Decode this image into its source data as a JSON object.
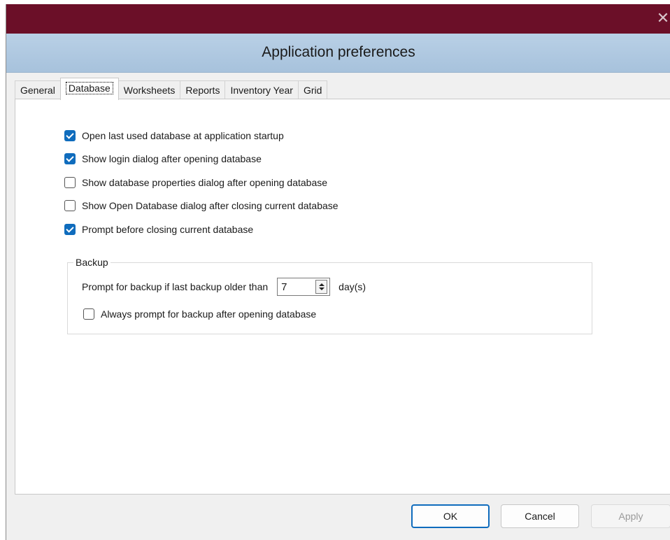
{
  "window": {
    "close_glyph": "✕"
  },
  "header": {
    "title": "Application preferences"
  },
  "tabs": [
    {
      "label": "General"
    },
    {
      "label": "Database",
      "active": true
    },
    {
      "label": "Worksheets"
    },
    {
      "label": "Reports"
    },
    {
      "label": "Inventory Year"
    },
    {
      "label": "Grid"
    }
  ],
  "options": [
    {
      "label": "Open last used database at application startup",
      "checked": true
    },
    {
      "label": "Show login dialog after opening database",
      "checked": true
    },
    {
      "label": "Show database properties dialog after opening database",
      "checked": false
    },
    {
      "label": "Show Open Database dialog after closing current database",
      "checked": false
    },
    {
      "label": "Prompt before closing current database",
      "checked": true
    }
  ],
  "backup": {
    "legend": "Backup",
    "prompt_label": "Prompt for backup if last backup older than",
    "days_value": "7",
    "days_unit": "day(s)",
    "always_label": "Always prompt for backup after opening database",
    "always_checked": false
  },
  "buttons": {
    "ok": "OK",
    "cancel": "Cancel",
    "apply": "Apply"
  },
  "colors": {
    "titlebar": "#6b0f28",
    "header_band": "#b9d0e6",
    "accent": "#0f6cbd"
  }
}
